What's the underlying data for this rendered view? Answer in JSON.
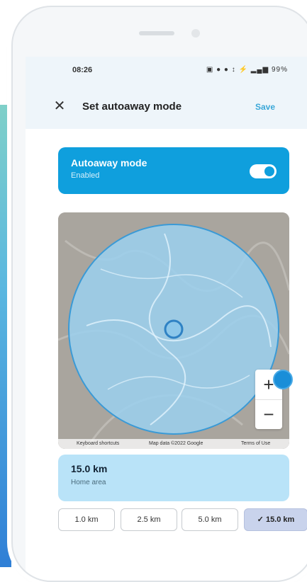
{
  "status_bar": {
    "time": "08:26",
    "icons_text": "▣ ● ● ↕ ⚡ ▂▄▆ 99%"
  },
  "app_bar": {
    "close_glyph": "✕",
    "title": "Set autoaway mode",
    "save_label": "Save"
  },
  "autoaway_card": {
    "title": "Autoaway mode",
    "subtitle": "Enabled",
    "toggle_on": true
  },
  "map": {
    "zoom_in": "+",
    "zoom_out": "−",
    "attribution": {
      "shortcuts": "Keyboard shortcuts",
      "map_data": "Map data ©2022 Google",
      "terms": "Terms of Use"
    }
  },
  "radius_card": {
    "value": "15.0 km",
    "label": "Home area"
  },
  "radius_options": [
    {
      "label": "1.0 km",
      "selected": false
    },
    {
      "label": "2.5 km",
      "selected": false
    },
    {
      "label": "5.0 km",
      "selected": false
    },
    {
      "label": "✓ 15.0 km",
      "selected": true
    }
  ],
  "colors": {
    "accent": "#0f9fdd",
    "radius_fill": "#9bd0ee",
    "side_gradient_top": "#7fd0c9",
    "side_gradient_bottom": "#2f7fd6"
  },
  "icons": {
    "close": "close-icon",
    "toggle": "toggle-switch",
    "zoom_in": "plus-icon",
    "zoom_out": "minus-icon",
    "checkmark": "check-icon"
  }
}
